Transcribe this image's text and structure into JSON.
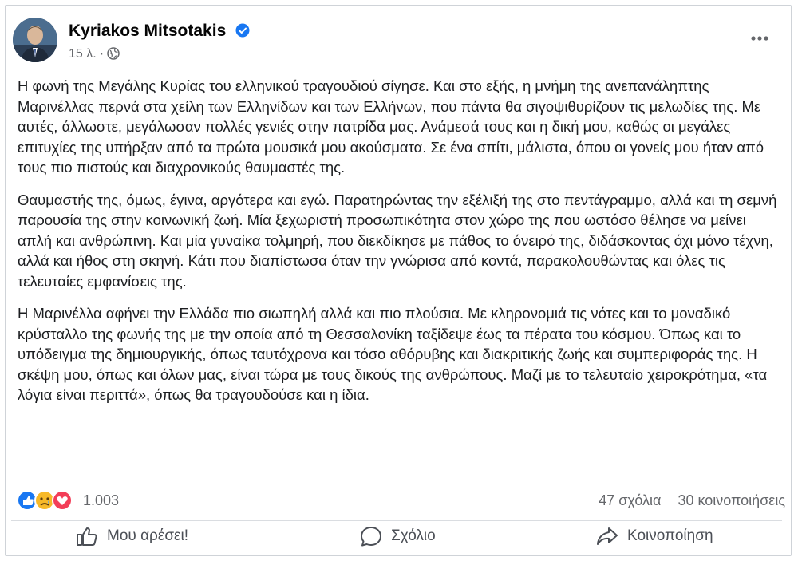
{
  "post": {
    "author_name": "Kyriakos Mitsotakis",
    "timestamp": "15 λ.",
    "separator": "·",
    "verified_icon": "verified-badge-icon",
    "audience_icon": "globe-icon",
    "paragraphs": [
      "Η φωνή της Μεγάλης Κυρίας του ελληνικού τραγουδιού σίγησε. Και στο εξής, η μνήμη της ανεπανάληπτης Μαρινέλλας περνά στα χείλη των Ελληνίδων και των Ελλήνων, που πάντα θα σιγοψιθυρίζουν τις μελωδίες της. Με αυτές, άλλωστε, μεγάλωσαν πολλές γενιές στην πατρίδα μας. Ανάμεσά τους και η δική μου, καθώς οι μεγάλες επιτυχίες της υπήρξαν από τα πρώτα μουσικά μου ακούσματα. Σε ένα σπίτι, μάλιστα, όπου οι γονείς μου ήταν από τους πιο πιστούς και διαχρονικούς θαυμαστές της.",
      "Θαυμαστής της, όμως, έγινα, αργότερα και εγώ. Παρατηρώντας την εξέλιξή της στο πεντάγραμμο, αλλά και τη σεμνή παρουσία της στην κοινωνική ζωή. Μία ξεχωριστή προσωπικότητα στον χώρο της που ωστόσο θέλησε να μείνει απλή και ανθρώπινη. Και μία γυναίκα τολμηρή, που διεκδίκησε με πάθος το όνειρό της, διδάσκοντας όχι μόνο τέχνη, αλλά και ήθος στη σκηνή. Κάτι που διαπίστωσα όταν την γνώρισα από κοντά, παρακολουθώντας και όλες τις τελευταίες εμφανίσεις της.",
      "Η Μαρινέλλα αφήνει την Ελλάδα πιο σιωπηλή αλλά και πιο πλούσια. Με κληρονομιά τις νότες και το μοναδικό κρύσταλλο της φωνής της με την οποία  από τη Θεσσαλονίκη ταξίδεψε έως τα πέρατα του κόσμου. Όπως και το υπόδειγμα της δημιουργικής, όπως ταυτόχρονα και τόσο αθόρυβης και διακριτικής ζωής και συμπεριφοράς της. Η σκέψη μου, όπως και όλων μας, είναι τώρα με τους δικούς της ανθρώπους. Μαζί με το τελευταίο χειροκρότημα, «τα λόγια είναι περιττά», όπως θα τραγουδούσε και η ίδια."
    ]
  },
  "stats": {
    "reaction_icons": [
      "like-reaction-icon",
      "sad-reaction-icon",
      "love-reaction-icon"
    ],
    "reactions_count": "1.003",
    "comments": "47 σχόλια",
    "shares": "30 κοινοποιήσεις"
  },
  "actions": {
    "like_label": "Μου αρέσει!",
    "comment_label": "Σχόλιο",
    "share_label": "Κοινοποίηση"
  },
  "colors": {
    "like_blue": "#1877f2",
    "love_red": "#f33e58",
    "sad_yellow": "#f7b928",
    "secondary_text": "#65676b"
  }
}
